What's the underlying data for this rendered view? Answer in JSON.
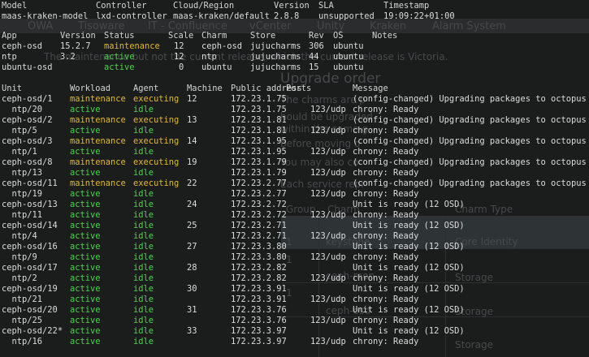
{
  "background": {
    "bookmarks": [
      "OWA",
      "Tisoware",
      "IT - Confluence",
      "vCenter",
      "Unity",
      "Kraken",
      "Alarm System"
    ],
    "page_line1": "The maintenance but not the current release, which the current release is Victoria.",
    "heading": "Upgrade order",
    "paragraph": [
      "The charms are p",
      "hould be upgraded",
      "within the same g",
      "before moving o",
      "You may also co",
      "Each service repr"
    ],
    "table_head": [
      "Group",
      "Charm",
      "Charm Type"
    ],
    "table_rows": [
      [
        "1",
        "keystone",
        "Core Identity"
      ],
      [
        "1",
        "ceph-mon",
        "Storage"
      ],
      [
        "1",
        "ceph-osd",
        "Storage"
      ],
      [
        "",
        "",
        "Storage"
      ]
    ]
  },
  "model_header": {
    "columns": [
      "Model",
      "Controller",
      "Cloud/Region",
      "Version",
      "SLA",
      "Timestamp"
    ],
    "values": [
      "maas-kraken-model",
      "lxd-controller",
      "maas-kraken/default",
      "2.8.8",
      "unsupported",
      "19:09:22+01:00"
    ]
  },
  "apps": {
    "columns": [
      "App",
      "Version",
      "Status",
      "Scale",
      "Charm",
      "Store",
      "Rev",
      "OS",
      "Notes"
    ],
    "rows": [
      {
        "app": "ceph-osd",
        "version": "15.2.7",
        "status": "maintenance",
        "scale": "12",
        "charm": "ceph-osd",
        "store": "jujucharms",
        "rev": "306",
        "os": "ubuntu"
      },
      {
        "app": "ntp",
        "version": "3.2",
        "status": "active",
        "scale": "12",
        "charm": "ntp",
        "store": "jujucharms",
        "rev": "44",
        "os": "ubuntu"
      },
      {
        "app": "ubuntu-osd",
        "version": "",
        "status": "active",
        "scale": "0",
        "charm": "ubuntu",
        "store": "jujucharms",
        "rev": "15",
        "os": "ubuntu"
      }
    ]
  },
  "units": {
    "columns": [
      "Unit",
      "Workload",
      "Agent",
      "Machine",
      "Public address",
      "Ports",
      "Message"
    ],
    "rows": [
      {
        "unit": "ceph-osd/1",
        "workload": "maintenance",
        "agent": "executing",
        "machine": "12",
        "address": "172.23.1.75",
        "ports": "",
        "message": "(config-changed) Upgrading packages to octopus"
      },
      {
        "unit": "  ntp/20",
        "workload": "active",
        "agent": "idle",
        "machine": "",
        "address": "172.23.1.75",
        "ports": "123/udp",
        "message": "chrony: Ready"
      },
      {
        "unit": "ceph-osd/2",
        "workload": "maintenance",
        "agent": "executing",
        "machine": "13",
        "address": "172.23.1.81",
        "ports": "",
        "message": "(config-changed) Upgrading packages to octopus"
      },
      {
        "unit": "  ntp/5",
        "workload": "active",
        "agent": "idle",
        "machine": "",
        "address": "172.23.1.81",
        "ports": "123/udp",
        "message": "chrony: Ready"
      },
      {
        "unit": "ceph-osd/3",
        "workload": "maintenance",
        "agent": "executing",
        "machine": "14",
        "address": "172.23.1.95",
        "ports": "",
        "message": "(config-changed) Upgrading packages to octopus"
      },
      {
        "unit": "  ntp/1",
        "workload": "active",
        "agent": "idle",
        "machine": "",
        "address": "172.23.1.95",
        "ports": "123/udp",
        "message": "chrony: Ready"
      },
      {
        "unit": "ceph-osd/8",
        "workload": "maintenance",
        "agent": "executing",
        "machine": "19",
        "address": "172.23.1.79",
        "ports": "",
        "message": "(config-changed) Upgrading packages to octopus"
      },
      {
        "unit": "  ntp/13",
        "workload": "active",
        "agent": "idle",
        "machine": "",
        "address": "172.23.1.79",
        "ports": "123/udp",
        "message": "chrony: Ready"
      },
      {
        "unit": "ceph-osd/11",
        "workload": "maintenance",
        "agent": "executing",
        "machine": "22",
        "address": "172.23.2.77",
        "ports": "",
        "message": "(config-changed) Upgrading packages to octopus"
      },
      {
        "unit": "  ntp/19",
        "workload": "active",
        "agent": "idle",
        "machine": "",
        "address": "172.23.2.77",
        "ports": "123/udp",
        "message": "chrony: Ready"
      },
      {
        "unit": "ceph-osd/13",
        "workload": "active",
        "agent": "idle",
        "machine": "24",
        "address": "172.23.2.72",
        "ports": "",
        "message": "Unit is ready (12 OSD)"
      },
      {
        "unit": "  ntp/11",
        "workload": "active",
        "agent": "idle",
        "machine": "",
        "address": "172.23.2.72",
        "ports": "123/udp",
        "message": "chrony: Ready"
      },
      {
        "unit": "ceph-osd/14",
        "workload": "active",
        "agent": "idle",
        "machine": "25",
        "address": "172.23.2.71",
        "ports": "",
        "message": "Unit is ready (12 OSD)"
      },
      {
        "unit": "  ntp/4",
        "workload": "active",
        "agent": "idle",
        "machine": "",
        "address": "172.23.2.71",
        "ports": "123/udp",
        "message": "chrony: Ready"
      },
      {
        "unit": "ceph-osd/16",
        "workload": "active",
        "agent": "idle",
        "machine": "27",
        "address": "172.23.3.80",
        "ports": "",
        "message": "Unit is ready (12 OSD)"
      },
      {
        "unit": "  ntp/9",
        "workload": "active",
        "agent": "idle",
        "machine": "",
        "address": "172.23.3.80",
        "ports": "123/udp",
        "message": "chrony: Ready"
      },
      {
        "unit": "ceph-osd/17",
        "workload": "active",
        "agent": "idle",
        "machine": "28",
        "address": "172.23.2.82",
        "ports": "",
        "message": "Unit is ready (12 OSD)"
      },
      {
        "unit": "  ntp/2",
        "workload": "active",
        "agent": "idle",
        "machine": "",
        "address": "172.23.2.82",
        "ports": "123/udp",
        "message": "chrony: Ready"
      },
      {
        "unit": "ceph-osd/19",
        "workload": "active",
        "agent": "idle",
        "machine": "30",
        "address": "172.23.3.91",
        "ports": "",
        "message": "Unit is ready (12 OSD)"
      },
      {
        "unit": "  ntp/21",
        "workload": "active",
        "agent": "idle",
        "machine": "",
        "address": "172.23.3.91",
        "ports": "123/udp",
        "message": "chrony: Ready"
      },
      {
        "unit": "ceph-osd/20",
        "workload": "active",
        "agent": "idle",
        "machine": "31",
        "address": "172.23.3.76",
        "ports": "",
        "message": "Unit is ready (12 OSD)"
      },
      {
        "unit": "  ntp/25",
        "workload": "active",
        "agent": "idle",
        "machine": "",
        "address": "172.23.3.76",
        "ports": "123/udp",
        "message": "chrony: Ready"
      },
      {
        "unit": "ceph-osd/22*",
        "workload": "active",
        "agent": "idle",
        "machine": "33",
        "address": "172.23.3.97",
        "ports": "",
        "message": "Unit is ready (12 OSD)"
      },
      {
        "unit": "  ntp/16",
        "workload": "active",
        "agent": "idle",
        "machine": "",
        "address": "172.23.3.97",
        "ports": "123/udp",
        "message": "chrony: Ready"
      }
    ]
  },
  "colors": {
    "active": "#49d649",
    "maintenance": "#e2b92d",
    "executing": "#e2b92d",
    "idle": "#49d649"
  }
}
